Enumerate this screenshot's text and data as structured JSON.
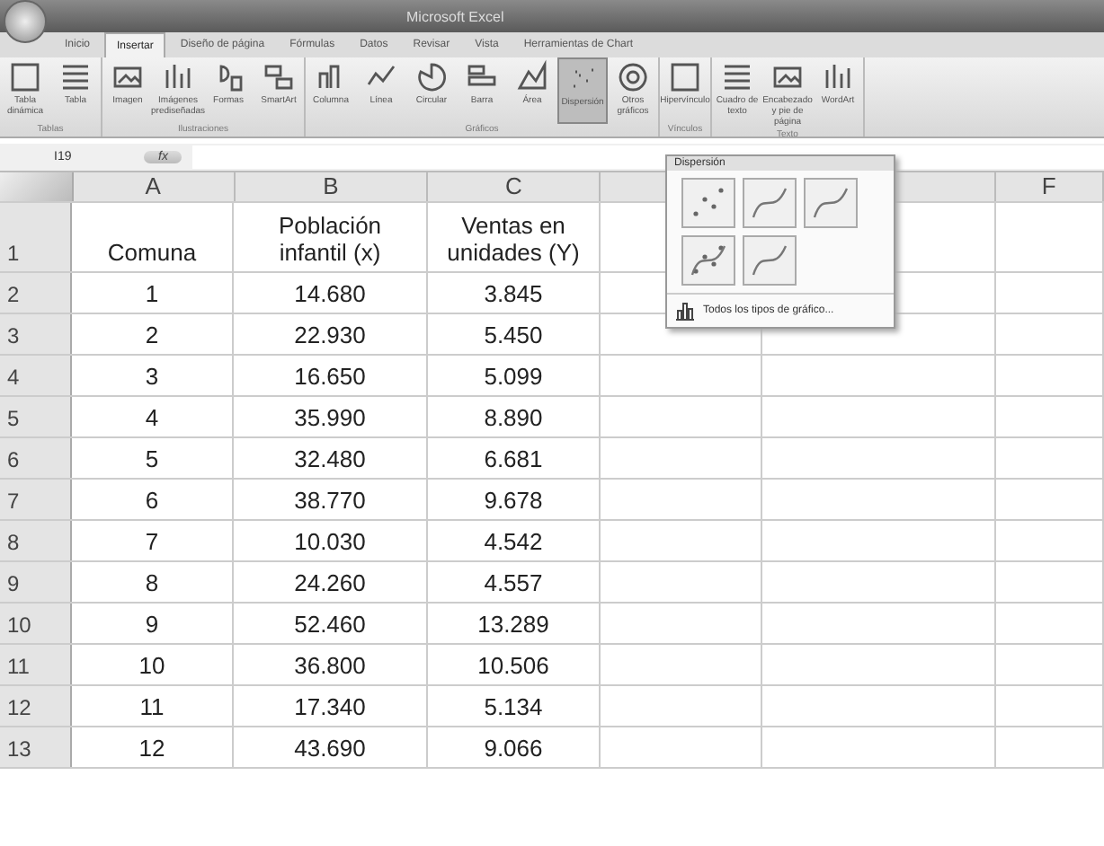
{
  "window": {
    "title": "Microsoft Excel"
  },
  "tabs": [
    {
      "label": "Inicio",
      "selected": false
    },
    {
      "label": "Insertar",
      "selected": true
    },
    {
      "label": "Diseño de página",
      "selected": false
    },
    {
      "label": "Fórmulas",
      "selected": false
    },
    {
      "label": "Datos",
      "selected": false
    },
    {
      "label": "Revisar",
      "selected": false
    },
    {
      "label": "Vista",
      "selected": false
    },
    {
      "label": "Herramientas de Chart",
      "selected": false
    }
  ],
  "ribbon": {
    "groups": [
      {
        "label": "Tablas",
        "buttons": [
          {
            "label": "Tabla dinámica",
            "selected": false
          },
          {
            "label": "Tabla",
            "selected": false
          }
        ]
      },
      {
        "label": "Ilustraciones",
        "buttons": [
          {
            "label": "Imagen",
            "selected": false
          },
          {
            "label": "Imágenes prediseñadas",
            "selected": false
          },
          {
            "label": "Formas",
            "selected": false
          },
          {
            "label": "SmartArt",
            "selected": false
          }
        ]
      },
      {
        "label": "Gráficos",
        "buttons": [
          {
            "label": "Columna",
            "selected": false
          },
          {
            "label": "Línea",
            "selected": false
          },
          {
            "label": "Circular",
            "selected": false
          },
          {
            "label": "Barra",
            "selected": false
          },
          {
            "label": "Área",
            "selected": false
          },
          {
            "label": "Dispersión",
            "selected": true
          },
          {
            "label": "Otros gráficos",
            "selected": false
          }
        ]
      },
      {
        "label": "Vínculos",
        "buttons": [
          {
            "label": "Hipervínculo",
            "selected": false
          }
        ]
      },
      {
        "label": "Texto",
        "buttons": [
          {
            "label": "Cuadro de texto",
            "selected": false
          },
          {
            "label": "Encabezado y pie de página",
            "selected": false
          },
          {
            "label": "WordArt",
            "selected": false
          }
        ]
      }
    ]
  },
  "name_box": "I19",
  "formula_icon": "fx",
  "dropdown": {
    "title": "Dispersión",
    "footer": "Todos los tipos de gráfico..."
  },
  "columns": [
    "A",
    "B",
    "C",
    "F"
  ],
  "rows": [
    {
      "number": "1",
      "cells": [
        "Comuna",
        "Población infantil (x)",
        "Ventas en unidades (Y)"
      ]
    },
    {
      "number": "2",
      "cells": [
        "1",
        "14.680",
        "3.845"
      ]
    },
    {
      "number": "3",
      "cells": [
        "2",
        "22.930",
        "5.450"
      ]
    },
    {
      "number": "4",
      "cells": [
        "3",
        "16.650",
        "5.099"
      ]
    },
    {
      "number": "5",
      "cells": [
        "4",
        "35.990",
        "8.890"
      ]
    },
    {
      "number": "6",
      "cells": [
        "5",
        "32.480",
        "6.681"
      ]
    },
    {
      "number": "7",
      "cells": [
        "6",
        "38.770",
        "9.678"
      ]
    },
    {
      "number": "8",
      "cells": [
        "7",
        "10.030",
        "4.542"
      ]
    },
    {
      "number": "9",
      "cells": [
        "8",
        "24.260",
        "4.557"
      ]
    },
    {
      "number": "10",
      "cells": [
        "9",
        "52.460",
        "13.289"
      ]
    },
    {
      "number": "11",
      "cells": [
        "10",
        "36.800",
        "10.506"
      ]
    },
    {
      "number": "12",
      "cells": [
        "11",
        "17.340",
        "5.134"
      ]
    },
    {
      "number": "13",
      "cells": [
        "12",
        "43.690",
        "9.066"
      ]
    }
  ]
}
